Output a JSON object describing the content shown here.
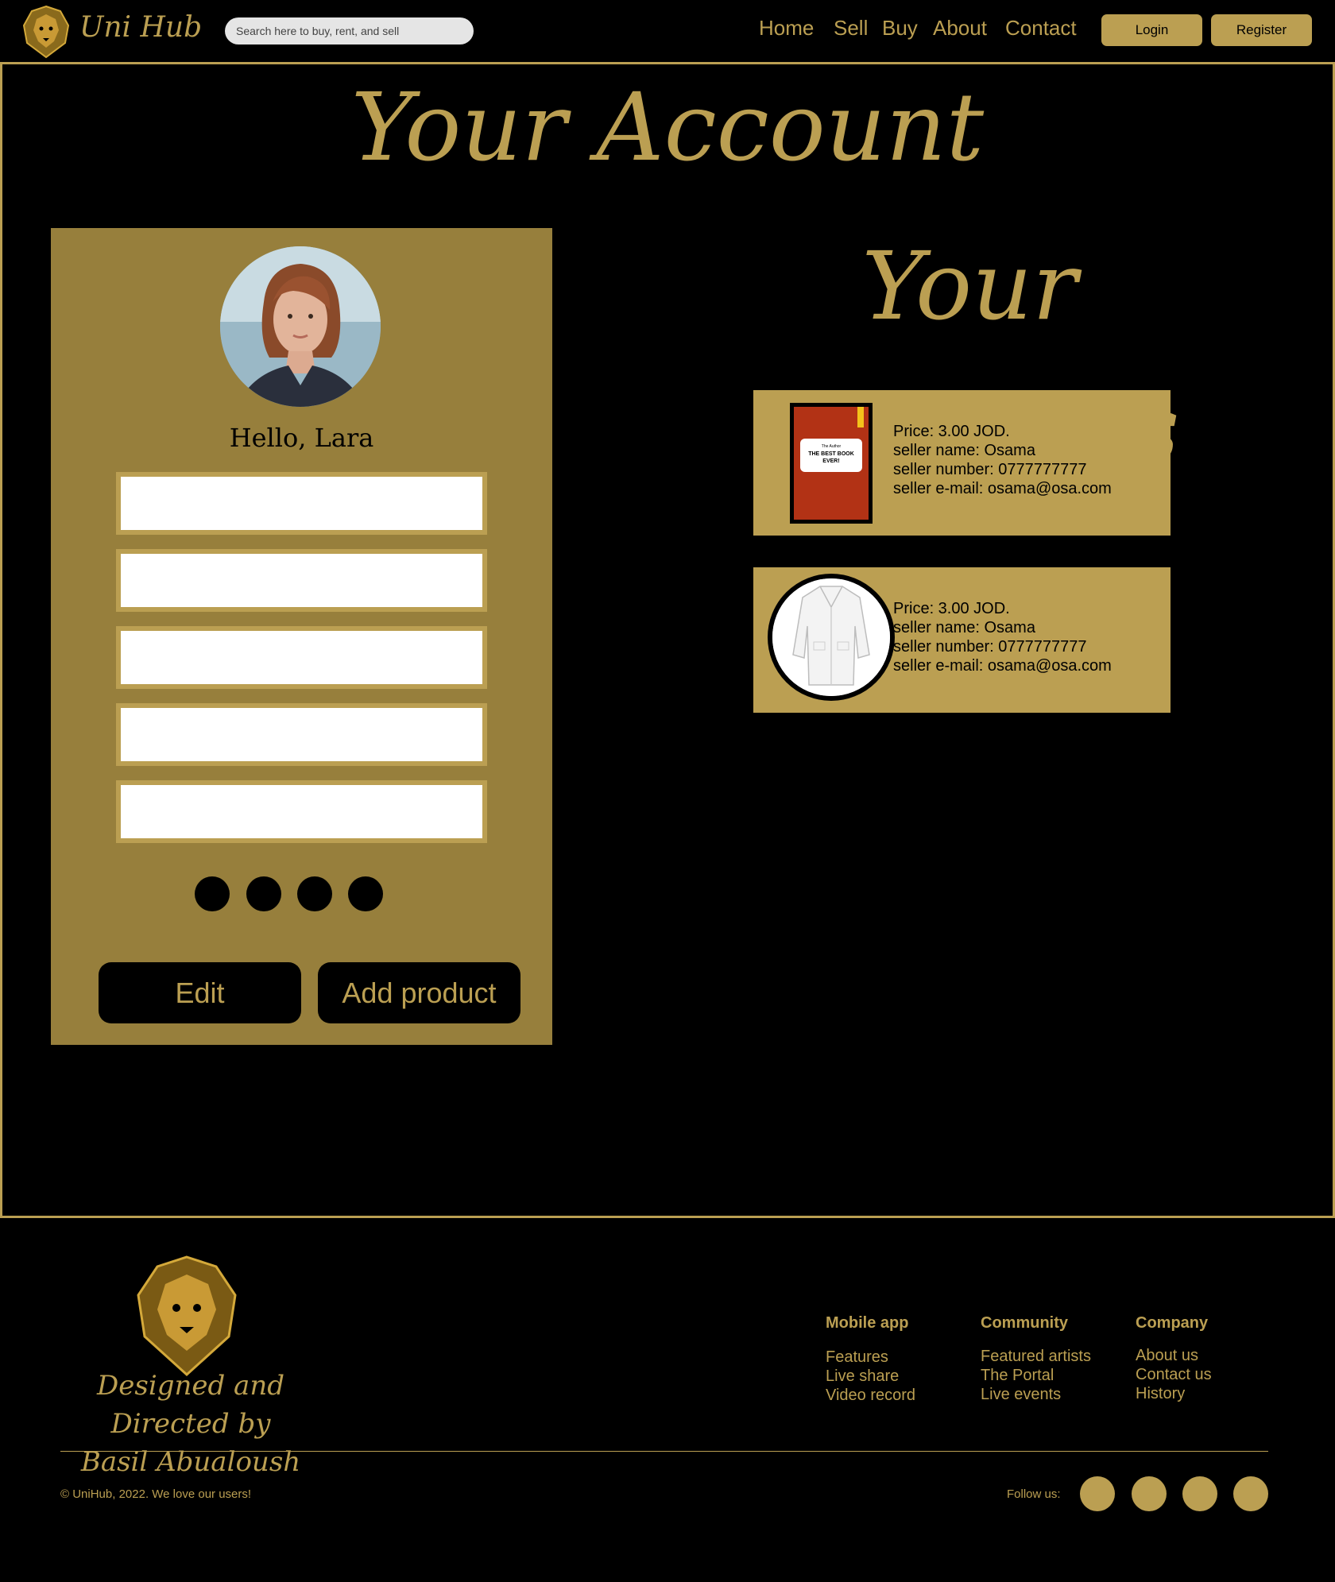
{
  "header": {
    "brand": "Uni Hub",
    "search_placeholder": "Search here to buy, rent, and sell",
    "nav": [
      "Home",
      "Sell",
      "Buy",
      "About",
      "Contact"
    ],
    "login_label": "Login",
    "register_label": "Register"
  },
  "page_title": "Your Account",
  "account": {
    "greeting": "Hello, Lara",
    "fields": [
      "",
      "",
      "",
      "",
      ""
    ],
    "edit_label": "Edit",
    "add_product_label": "Add product"
  },
  "products_title": "Your products",
  "products": [
    {
      "image": "book-cover-icon",
      "book_small": "The Author",
      "book_title": "THE BEST BOOK EVER!",
      "price": "Price: 3.00 JOD.",
      "seller_name": "seller name: Osama",
      "seller_number": "seller number: 0777777777",
      "seller_email": "seller e-mail: osama@osa.com"
    },
    {
      "image": "lab-coat-icon",
      "price": "Price: 3.00 JOD.",
      "seller_name": "seller name: Osama",
      "seller_number": "seller number: 0777777777",
      "seller_email": "seller e-mail: osama@osa.com"
    }
  ],
  "footer": {
    "credits_line1": "Designed and Directed by",
    "credits_line2": "Basil Abualoush",
    "columns": [
      {
        "heading": "Mobile app",
        "links": [
          "Features",
          "Live share",
          "Video record"
        ]
      },
      {
        "heading": "Community",
        "links": [
          "Featured artists",
          "The Portal",
          "Live events"
        ]
      },
      {
        "heading": "Company",
        "links": [
          "About us",
          "Contact us",
          "History"
        ]
      }
    ],
    "copyright": "© UniHub, 2022. We love our users!",
    "follow_label": "Follow us:"
  },
  "colors": {
    "accent": "#bb9f52",
    "card": "#977f3c",
    "background": "#000000"
  }
}
